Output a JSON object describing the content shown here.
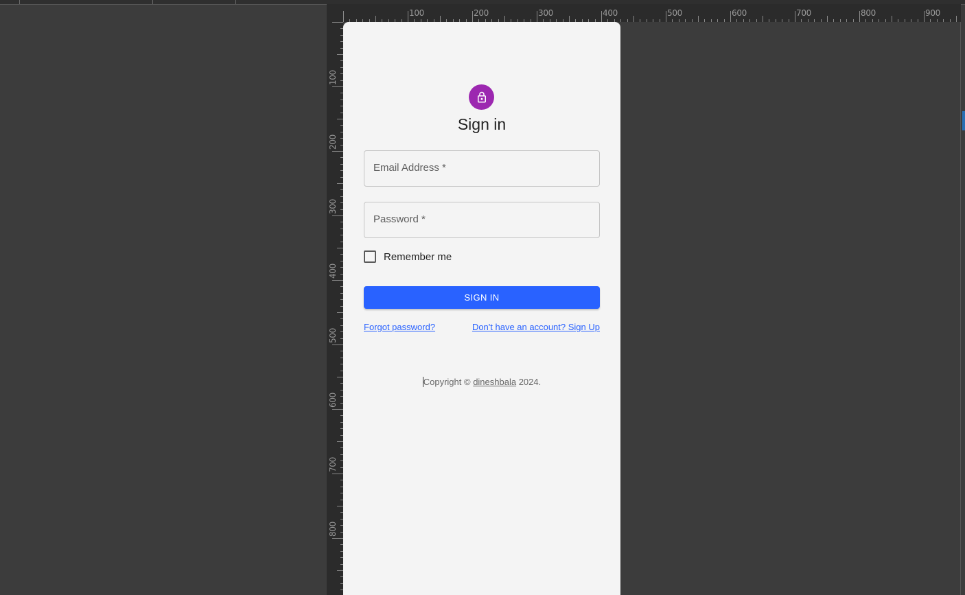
{
  "rulers": {
    "horizontal_labels": [
      "100",
      "200",
      "300",
      "400",
      "500",
      "600",
      "700",
      "800",
      "900"
    ],
    "vertical_labels": [
      "100",
      "200",
      "300",
      "400",
      "500",
      "600",
      "700",
      "800"
    ]
  },
  "signin": {
    "icon": "lock-icon",
    "accent_color": "#9c27b0",
    "title": "Sign in",
    "email_label": "Email Address *",
    "email_value": "",
    "password_label": "Password *",
    "password_value": "",
    "remember_label": "Remember me",
    "remember_checked": false,
    "submit_label": "SIGN IN",
    "button_color": "#2962ff",
    "forgot_label": "Forgot password?",
    "signup_label": "Don't have an account? Sign Up",
    "copyright_prefix": "Copyright ©",
    "copyright_link": "dineshbala",
    "copyright_suffix": "2024."
  }
}
